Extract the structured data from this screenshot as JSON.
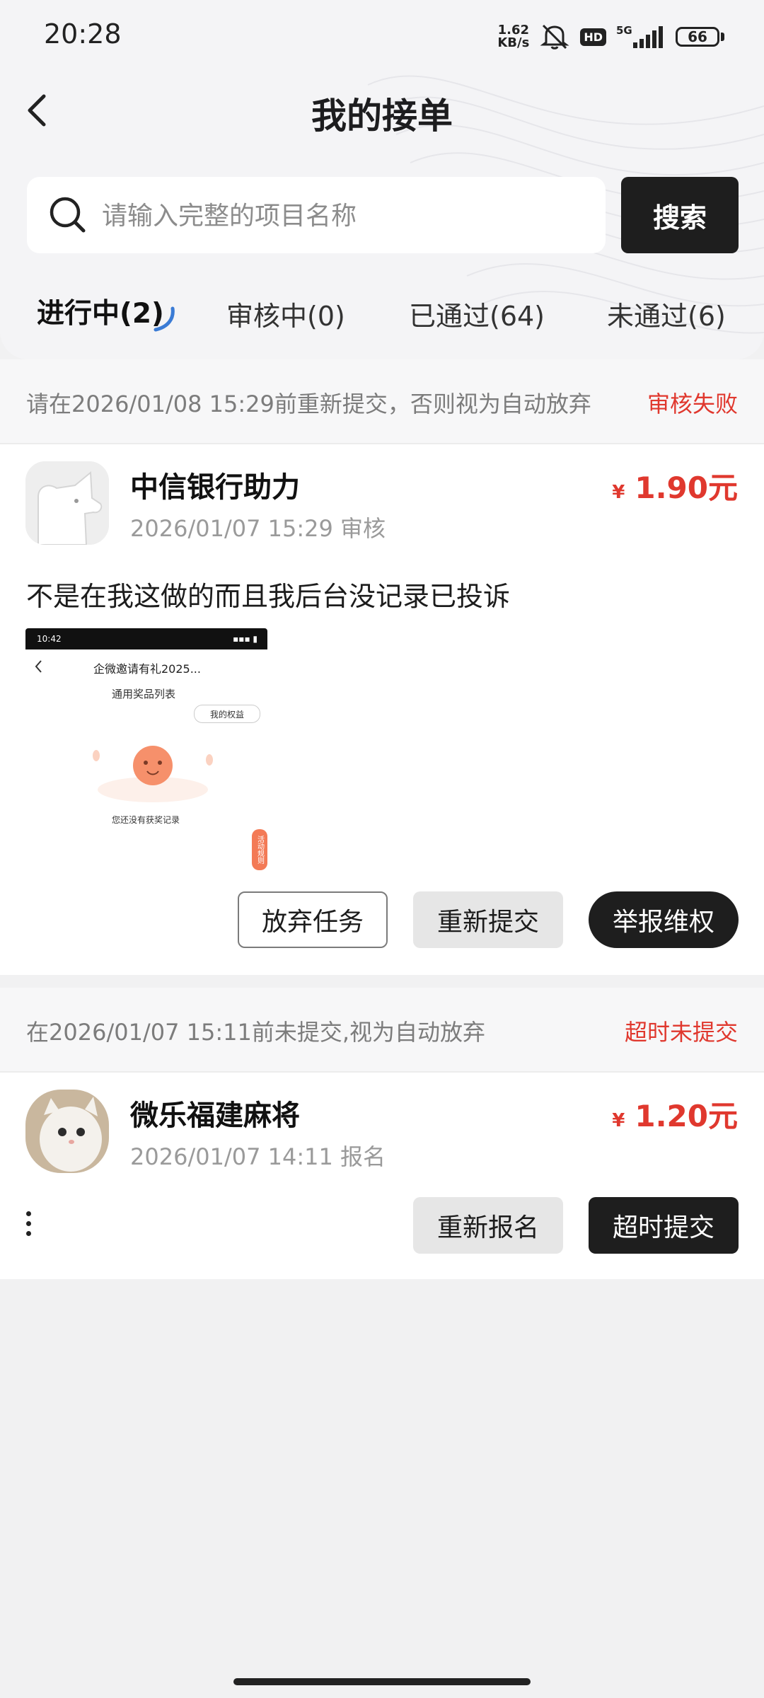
{
  "status_bar": {
    "time": "20:28",
    "speed_value": "1.62",
    "speed_unit": "KB/s",
    "hd": "HD",
    "network": "5G",
    "battery": "66"
  },
  "header": {
    "title": "我的接单"
  },
  "search": {
    "placeholder": "请输入完整的项目名称",
    "button": "搜索"
  },
  "tabs": [
    {
      "label": "进行中(2)",
      "active": true
    },
    {
      "label": "审核中(0)",
      "active": false
    },
    {
      "label": "已通过(64)",
      "active": false
    },
    {
      "label": "未通过(6)",
      "active": false
    }
  ],
  "orders": [
    {
      "notice": "请在2026/01/08 15:29前重新提交，否则视为自动放弃",
      "status": "审核失败",
      "name": "中信银行助力",
      "meta": "2026/01/07 15:29 审核",
      "currency": "¥",
      "price": "1.90元",
      "remark": "不是在我这做的而且我后台没记录已投诉",
      "screenshot": {
        "time": "10:42",
        "title": "企微邀请有礼2025...",
        "subtitle": "通用奖品列表",
        "pill": "我的权益",
        "empty": "您还没有获奖记录",
        "tag": "活动规则"
      },
      "buttons": [
        "放弃任务",
        "重新提交",
        "举报维权"
      ]
    },
    {
      "notice": "在2026/01/07 15:11前未提交,视为自动放弃",
      "status": "超时未提交",
      "name": "微乐福建麻将",
      "meta": "2026/01/07 14:11 报名",
      "currency": "¥",
      "price": "1.20元",
      "buttons": [
        "重新报名",
        "超时提交"
      ]
    }
  ]
}
